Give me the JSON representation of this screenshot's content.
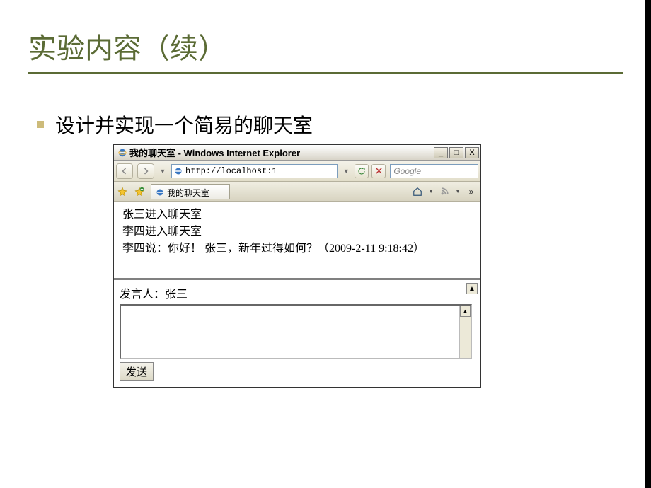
{
  "slide": {
    "title": "实验内容（续）",
    "bullet": "设计并实现一个简易的聊天室"
  },
  "browser": {
    "window_title": "我的聊天室 - Windows Internet Explorer",
    "url": "http://localhost:1",
    "search_placeholder": "Google",
    "tab_label": "我的聊天室",
    "chat_log": [
      "张三进入聊天室",
      "李四进入聊天室",
      "李四说：你好！ 张三，新年过得如何？（2009-2-11 9:18:42）"
    ],
    "speaker_label": "发言人：",
    "speaker_value": "张三",
    "send_button": "发送",
    "buttons": {
      "minimize": "_",
      "maximize": "□",
      "close": "X"
    }
  }
}
